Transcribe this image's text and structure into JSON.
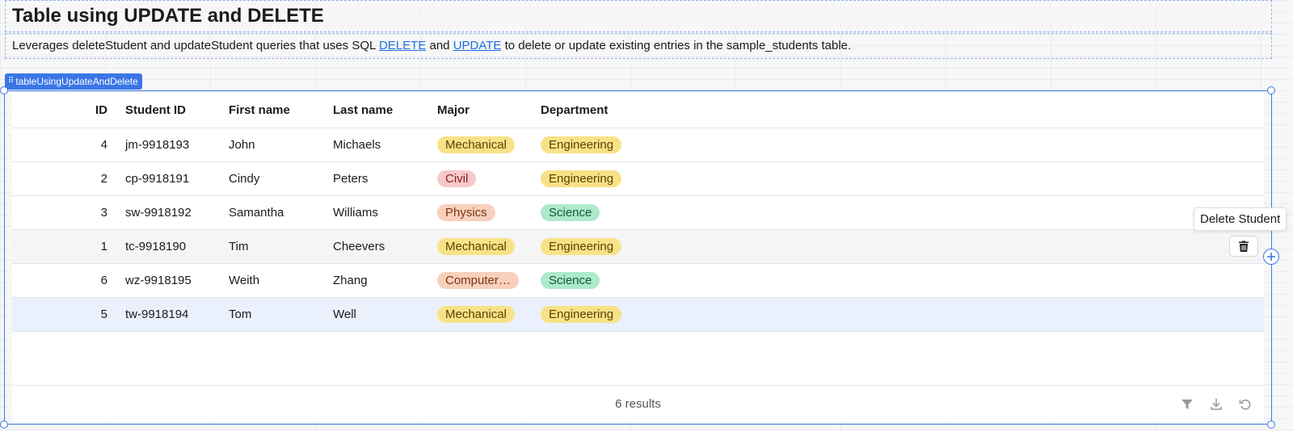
{
  "page": {
    "title": "Table using UPDATE and DELETE",
    "description": {
      "part1": "Leverages deleteStudent and updateStudent queries that uses SQL ",
      "link1": "DELETE",
      "part2": " and ",
      "link2": "UPDATE",
      "part3": " to delete or update existing entries in the sample_students table."
    }
  },
  "component": {
    "tag_label": "tableUsingUpdateAndDelete"
  },
  "table": {
    "columns": [
      "ID",
      "Student ID",
      "First name",
      "Last name",
      "Major",
      "Department"
    ],
    "rows": [
      {
        "id": "4",
        "student_id": "jm-9918193",
        "first": "John",
        "last": "Michaels",
        "major": "Mechanical",
        "major_color": "yellow",
        "dept": "Engineering",
        "dept_color": "yellow"
      },
      {
        "id": "2",
        "student_id": "cp-9918191",
        "first": "Cindy",
        "last": "Peters",
        "major": "Civil",
        "major_color": "red",
        "dept": "Engineering",
        "dept_color": "yellow"
      },
      {
        "id": "3",
        "student_id": "sw-9918192",
        "first": "Samantha",
        "last": "Williams",
        "major": "Physics",
        "major_color": "orange",
        "dept": "Science",
        "dept_color": "green"
      },
      {
        "id": "1",
        "student_id": "tc-9918190",
        "first": "Tim",
        "last": "Cheevers",
        "major": "Mechanical",
        "major_color": "yellow",
        "dept": "Engineering",
        "dept_color": "yellow"
      },
      {
        "id": "6",
        "student_id": "wz-9918195",
        "first": "Weith",
        "last": "Zhang",
        "major": "Computer…",
        "major_color": "orange",
        "dept": "Science",
        "dept_color": "green"
      },
      {
        "id": "5",
        "student_id": "tw-9918194",
        "first": "Tom",
        "last": "Well",
        "major": "Mechanical",
        "major_color": "yellow",
        "dept": "Engineering",
        "dept_color": "yellow"
      }
    ],
    "hover_row_index": 3,
    "selected_row_index": 5,
    "row_action_icon": "trash-icon",
    "tooltip": "Delete Student",
    "results_text": "6 results",
    "footer_icons": [
      "filter-icon",
      "download-icon",
      "refresh-icon"
    ]
  },
  "colors": {
    "accent": "#3a76e6",
    "link": "#1f6fe5",
    "selected_row": "#eaf1fd"
  }
}
